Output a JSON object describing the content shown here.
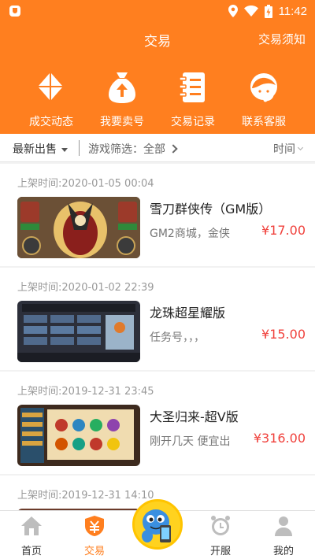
{
  "status_bar": {
    "time": "11:42"
  },
  "header": {
    "title": "交易",
    "notice_link": "交易须知"
  },
  "quick_menu": [
    {
      "label": "成交动态",
      "icon": "diamond-pinwheel-icon"
    },
    {
      "label": "我要卖号",
      "icon": "money-bag-upload-icon"
    },
    {
      "label": "交易记录",
      "icon": "notebook-icon"
    },
    {
      "label": "联系客服",
      "icon": "customer-service-icon"
    }
  ],
  "filter": {
    "latest": "最新出售",
    "game_filter": "游戏筛选：全部",
    "sort": "时间"
  },
  "listings": [
    {
      "time": "上架时间:2020-01-05 00:04",
      "title": "雪刀群侠传（GM版）",
      "desc": "GM2商城，金侠",
      "price": "¥17.00"
    },
    {
      "time": "上架时间:2020-01-02 22:39",
      "title": "龙珠超星耀版",
      "desc": "任务号，，，",
      "price": "¥15.00"
    },
    {
      "time": "上架时间:2019-12-31 23:45",
      "title": "大圣归来-超V版",
      "desc": "刚开几天 便宜出",
      "price": "¥316.00"
    },
    {
      "time": "上架时间:2019-12-31 14:10",
      "title": "",
      "desc": "",
      "price": ""
    }
  ],
  "bottom_nav": [
    {
      "label": "首页",
      "icon": "home-icon"
    },
    {
      "label": "交易",
      "icon": "trade-shield-icon",
      "active": true
    },
    {
      "label": "",
      "icon": "mascot-phone-icon"
    },
    {
      "label": "开服",
      "icon": "alarm-clock-icon"
    },
    {
      "label": "我的",
      "icon": "user-icon"
    }
  ],
  "colors": {
    "brand": "#ff7f1f",
    "price": "#f0413c",
    "muted": "#999999"
  }
}
